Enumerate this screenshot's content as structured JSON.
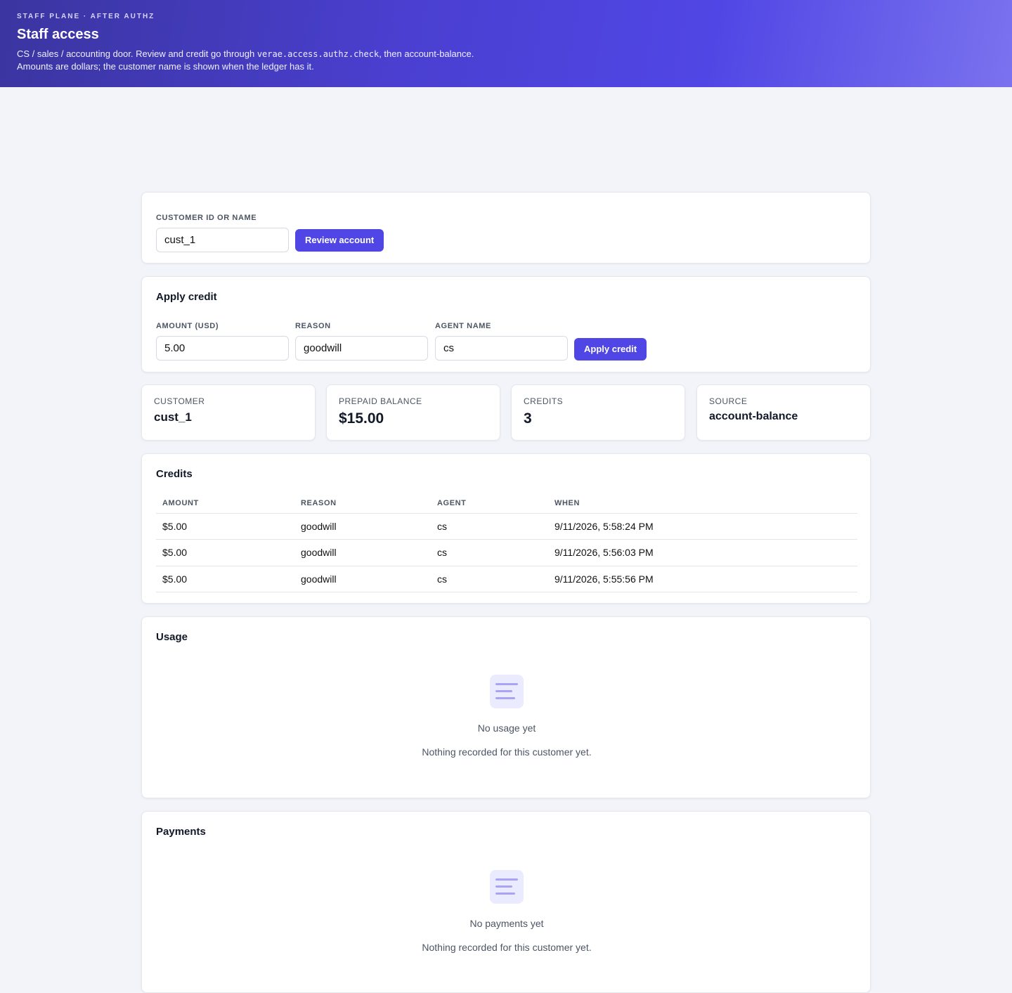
{
  "header": {
    "eyebrow": "STAFF PLANE · AFTER AUTHZ",
    "title": "Staff access",
    "desc_part1": "CS / sales / accounting door. Review and credit go through ",
    "desc_code": "verae.access.authz.check",
    "desc_part2": ", then account-balance.",
    "desc_line2": "Amounts are dollars; the customer name is shown when the ledger has it."
  },
  "lookup": {
    "label": "CUSTOMER ID OR NAME",
    "value": "cust_1",
    "button": "Review account"
  },
  "apply_credit": {
    "title": "Apply credit",
    "amount_label": "AMOUNT (USD)",
    "amount_value": "5.00",
    "reason_label": "REASON",
    "reason_value": "goodwill",
    "agent_label": "AGENT NAME",
    "agent_value": "cs",
    "button": "Apply credit"
  },
  "stats": [
    {
      "label": "CUSTOMER",
      "value": "cust_1"
    },
    {
      "label": "PREPAID BALANCE",
      "value": "$15.00"
    },
    {
      "label": "CREDITS",
      "value": "3"
    },
    {
      "label": "SOURCE",
      "value": "account-balance"
    }
  ],
  "credits": {
    "title": "Credits",
    "columns": [
      "AMOUNT",
      "REASON",
      "AGENT",
      "WHEN"
    ],
    "rows": [
      [
        "$5.00",
        "goodwill",
        "cs",
        "9/11/2026, 5:58:24 PM"
      ],
      [
        "$5.00",
        "goodwill",
        "cs",
        "9/11/2026, 5:56:03 PM"
      ],
      [
        "$5.00",
        "goodwill",
        "cs",
        "9/11/2026, 5:55:56 PM"
      ]
    ]
  },
  "usage": {
    "title": "Usage",
    "empty_title": "No usage yet",
    "empty_sub": "Nothing recorded for this customer yet.",
    "icon": "document-lines-icon"
  },
  "payments": {
    "title": "Payments",
    "empty_title": "No payments yet",
    "empty_sub": "Nothing recorded for this customer yet.",
    "icon": "document-lines-icon"
  },
  "colors": {
    "accent": "#4f46e5",
    "header_start": "#3a35a0",
    "header_end": "#7a72ee",
    "background": "#f3f4f9"
  }
}
